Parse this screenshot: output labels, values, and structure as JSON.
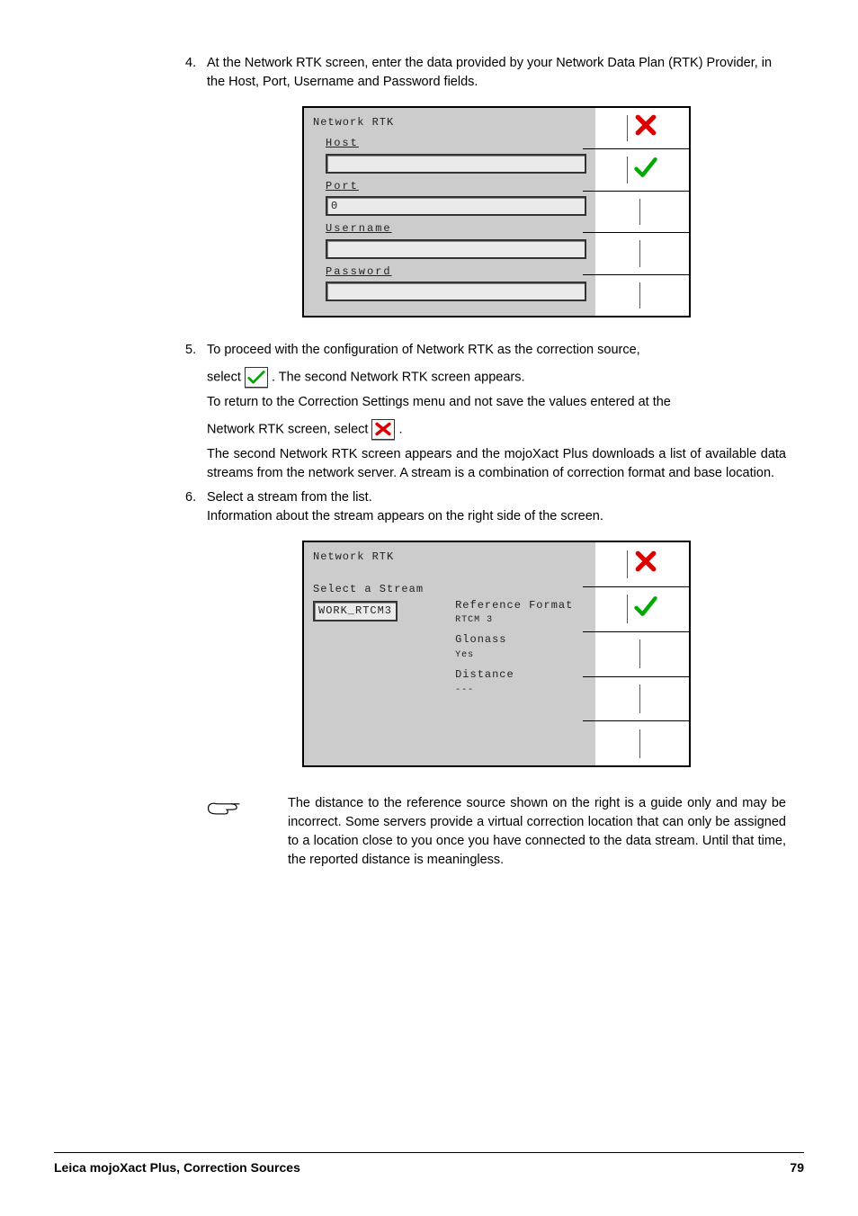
{
  "step4": {
    "num": "4.",
    "text": "At the Network RTK screen, enter the data provided by your Network Data Plan (RTK) Provider, in the Host, Port, Username and Password fields."
  },
  "screen1": {
    "title": "Network RTK",
    "fields": {
      "host": {
        "label": "Host",
        "value": ""
      },
      "port": {
        "label": "Port",
        "value": "0"
      },
      "username": {
        "label": "Username",
        "value": ""
      },
      "password": {
        "label": "Password",
        "value": ""
      }
    }
  },
  "step5": {
    "num": "5.",
    "line1": "To proceed with the configuration of Network RTK as the correction source,",
    "line2a": "select ",
    "line2b": ". The second Network RTK screen appears.",
    "line3": "To return to the Correction Settings menu and not save the values entered at the",
    "line4a": "Network RTK screen, select ",
    "line4b": ".",
    "line5": "The second Network RTK screen appears and the mojoXact Plus downloads a list of available data streams from the network server. A stream is a combination of correction format and base location."
  },
  "step6": {
    "num": "6.",
    "line1": "Select a stream from the list.",
    "line2": "Information about the stream appears on the right side of the screen."
  },
  "screen2": {
    "title": "Network RTK",
    "select_label": "Select a Stream",
    "selected": "WORK_RTCM3",
    "info": {
      "ref_label": "Reference Format",
      "ref_value": "RTCM 3",
      "glonass_label": "Glonass",
      "glonass_value": "Yes",
      "distance_label": "Distance",
      "distance_value": "---"
    }
  },
  "note": {
    "text": "The distance to the reference source shown on the right is a guide only and may be incorrect. Some servers provide a virtual correction location that can only be assigned to a location close to you once you have connected to the data stream. Until that time, the reported distance is meaningless."
  },
  "footer": {
    "left": "Leica mojoXact Plus, Correction Sources",
    "right": "79"
  }
}
